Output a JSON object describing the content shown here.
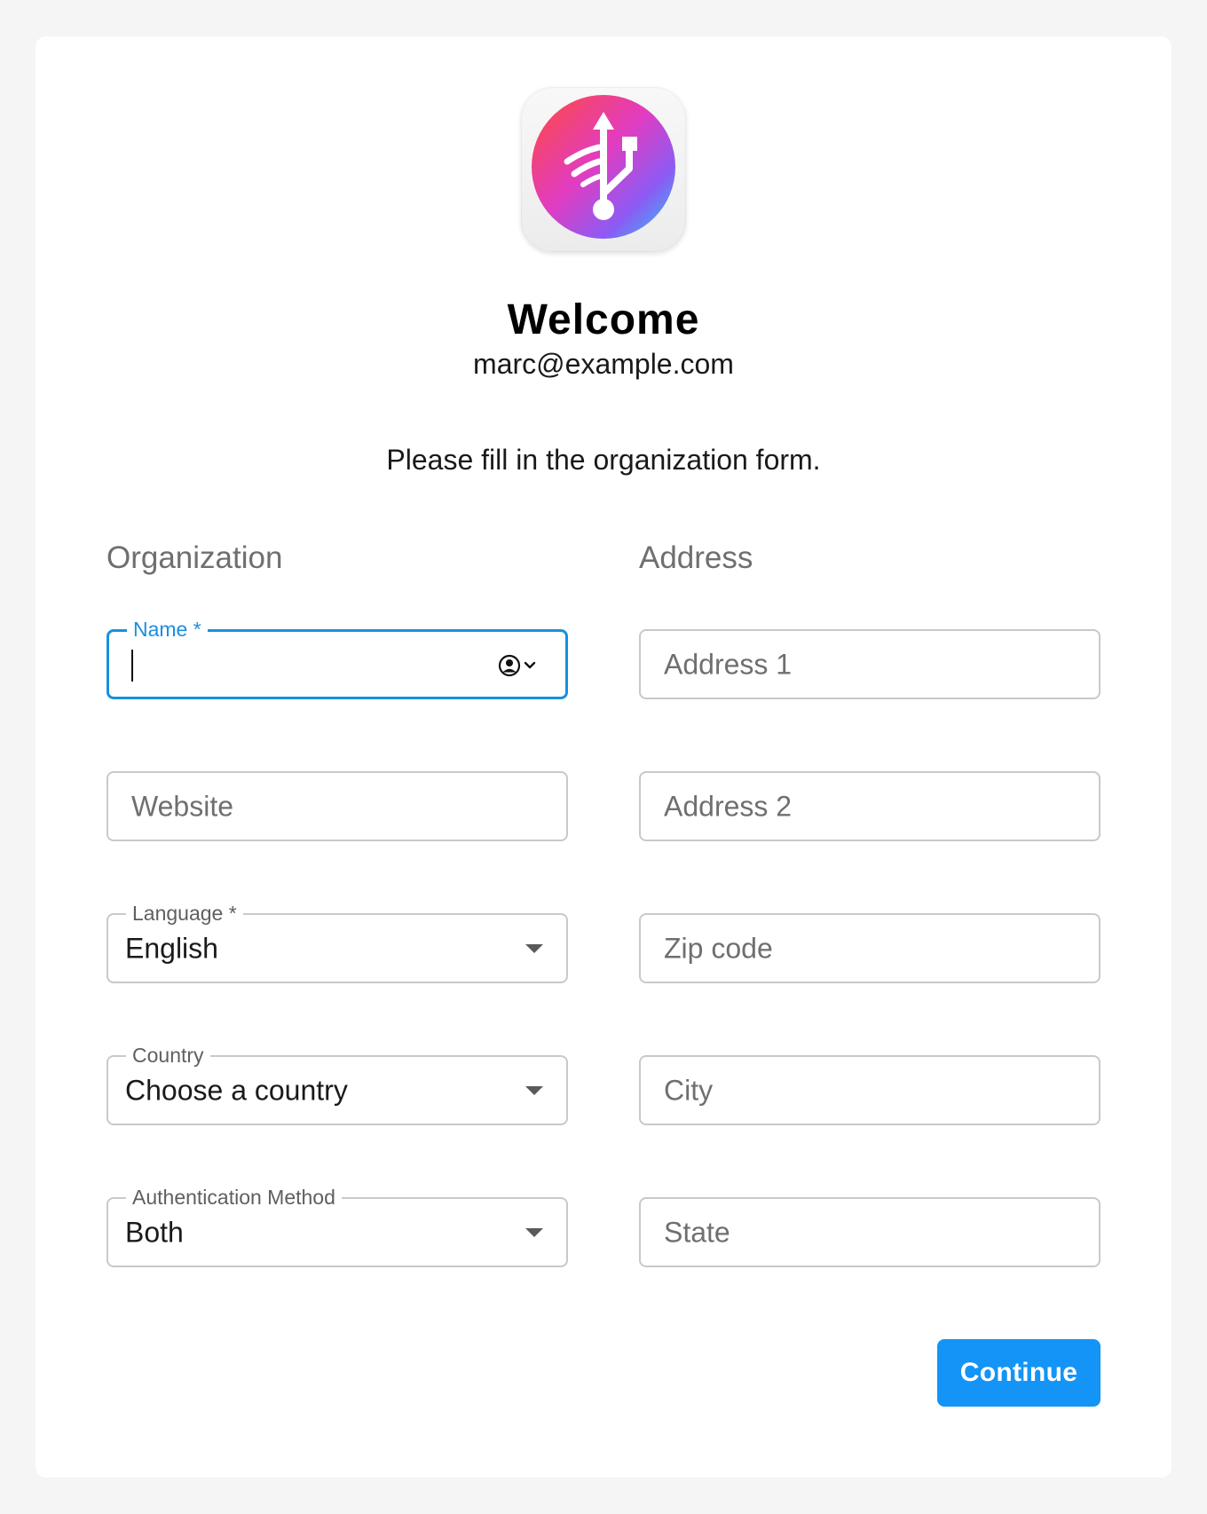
{
  "header": {
    "logo_icon": "usb-wireless-app-icon",
    "title": "Welcome",
    "email": "marc@example.com",
    "instructions": "Please fill in the organization form."
  },
  "organization": {
    "section_title": "Organization",
    "name": {
      "label": "Name *",
      "value": ""
    },
    "website": {
      "placeholder": "Website",
      "value": ""
    },
    "language": {
      "label": "Language *",
      "value": "English"
    },
    "country": {
      "label": "Country",
      "value": "Choose a country"
    },
    "auth_method": {
      "label": "Authentication Method",
      "value": "Both"
    }
  },
  "address": {
    "section_title": "Address",
    "address1": {
      "placeholder": "Address 1"
    },
    "address2": {
      "placeholder": "Address 2"
    },
    "zip": {
      "placeholder": "Zip code"
    },
    "city": {
      "placeholder": "City"
    },
    "state": {
      "placeholder": "State"
    }
  },
  "actions": {
    "continue_label": "Continue"
  },
  "colors": {
    "accent": "#1a8fe0",
    "button": "#1494f6",
    "background": "#f5f5f5"
  }
}
